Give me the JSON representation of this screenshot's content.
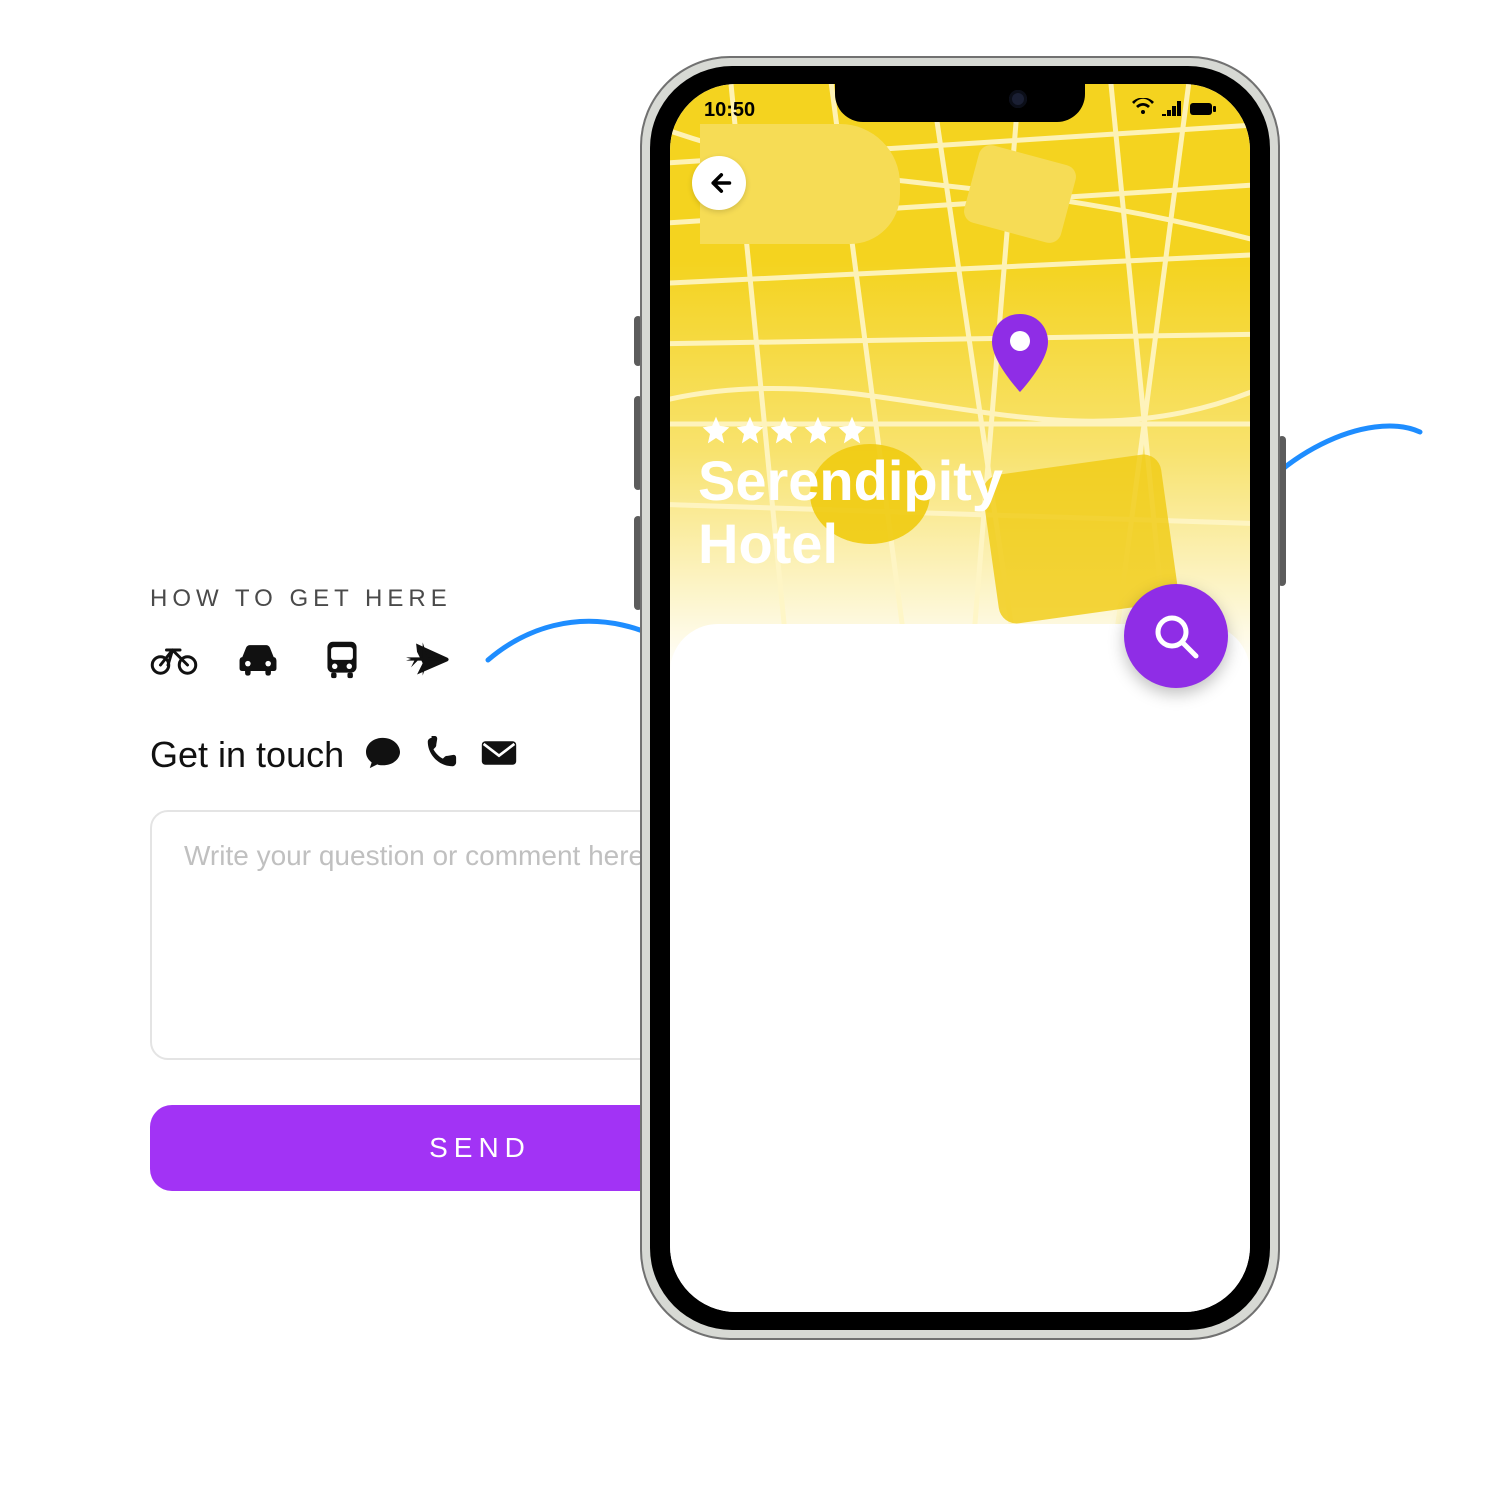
{
  "contact": {
    "how_title": "HOW TO GET HERE",
    "transport_icons": [
      "bicycle-icon",
      "car-icon",
      "bus-icon",
      "plane-icon"
    ],
    "get_in_touch_label": "Get in touch",
    "contact_icons": [
      "chat-icon",
      "phone-icon",
      "mail-icon"
    ],
    "question_placeholder": "Write your question or comment here.",
    "send_label": "SEND"
  },
  "phone": {
    "status": {
      "time": "10:50"
    },
    "hotel": {
      "rating": 5,
      "name": "Serendipity Hotel"
    },
    "actions": {
      "back": "back-button",
      "search": "search-button"
    }
  },
  "colors": {
    "accent_purple": "#9b1ff0",
    "map_yellow": "#f4d31f",
    "arrow_blue": "#1e8dff"
  }
}
